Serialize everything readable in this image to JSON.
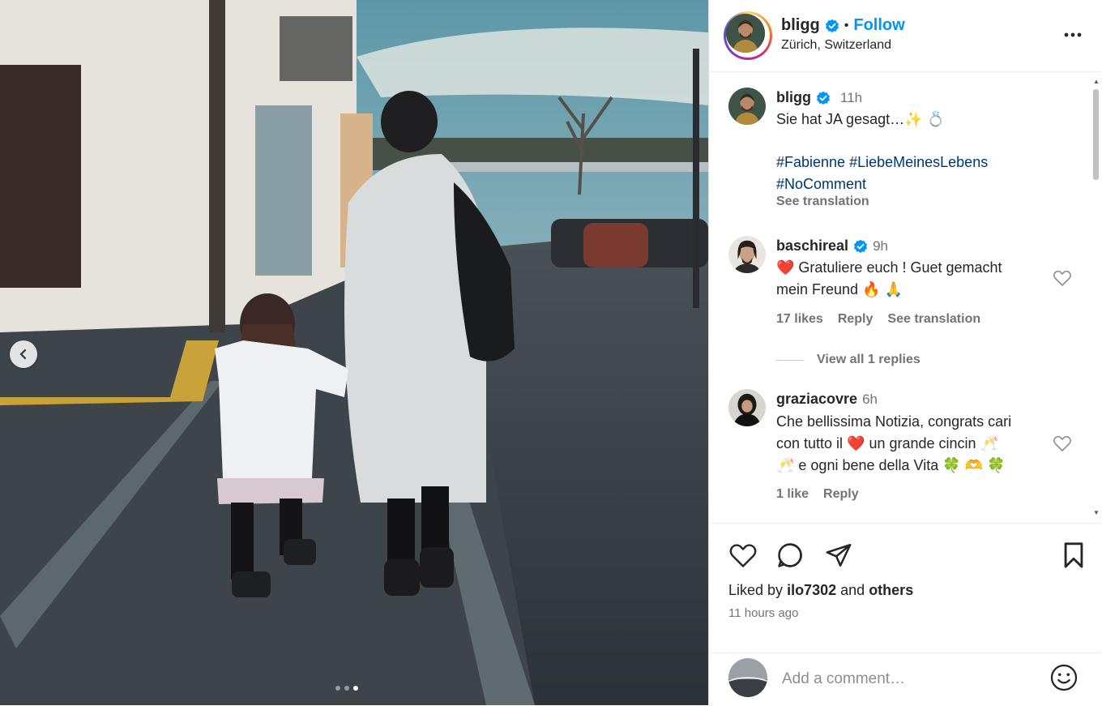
{
  "post": {
    "username": "bligg",
    "follow_label": "Follow",
    "separator": "•",
    "location": "Zürich, Switzerland",
    "more_icon": "more-horizontal-icon"
  },
  "caption": {
    "username": "bligg",
    "time": "11h",
    "text": "Sie hat JA gesagt…✨ 💍",
    "hashtags_line1": "#Fabienne #LiebeMeinesLebens",
    "hashtags_line2": "#NoComment",
    "see_translation": "See translation"
  },
  "comments": [
    {
      "username": "baschireal",
      "verified": true,
      "time": "9h",
      "text_line1": "❤️ Gratuliere euch ! Guet gemacht",
      "text_line2": "mein Freund 🔥 🙏",
      "likes": "17 likes",
      "reply": "Reply",
      "see_translation": "See translation",
      "view_replies": "View all 1 replies"
    },
    {
      "username": "graziacovre",
      "verified": false,
      "time": "6h",
      "text_line1": "Che bellissima Notizia, congrats cari",
      "text_line2": "con tutto il ❤️ un grande cincin 🥂",
      "text_line3": "🥂 e ogni bene della Vita 🍀 🫶 🍀",
      "likes": "1 like",
      "reply": "Reply"
    }
  ],
  "footer": {
    "liked_prefix": "Liked by",
    "liked_user": "ilo7302",
    "liked_and": "and",
    "liked_others": "others",
    "time_ago": "11 hours ago",
    "comment_placeholder": "Add a comment…"
  },
  "media": {
    "carousel_count": 3,
    "active_index": 2
  }
}
